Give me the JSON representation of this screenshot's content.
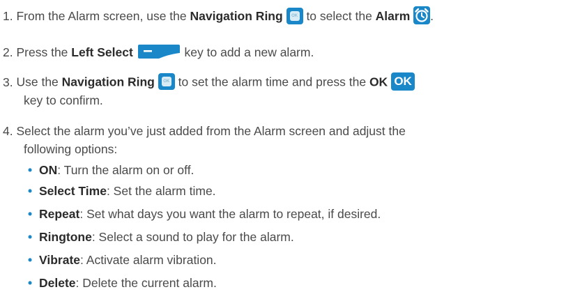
{
  "steps": [
    {
      "num": "1.",
      "t1": "From the Alarm screen, use the ",
      "b1": "Navigation Ring",
      "t2": " to select the ",
      "b2": "Alarm",
      "t3": "."
    },
    {
      "num": "2.",
      "t1": "Press the ",
      "b1": "Left Select",
      "t2": " key to add a new alarm."
    },
    {
      "num": "3.",
      "t1": "Use the ",
      "b1": "Navigation Ring",
      "t2": " to set the alarm time and press the ",
      "b2": "OK",
      "key": "OK",
      "line2": "key to confirm."
    },
    {
      "num": "4.",
      "line1": "Select the alarm you’ve just added from the Alarm screen and adjust the",
      "line2": "following options:"
    }
  ],
  "options": [
    {
      "term": "ON",
      "desc": ": Turn the alarm on or off."
    },
    {
      "term": "Select Time",
      "desc": ": Set the alarm time."
    },
    {
      "term": "Repeat",
      "desc": ": Set what days you want the alarm to repeat, if desired."
    },
    {
      "term": "Ringtone",
      "desc": ": Select a sound to play for the alarm."
    },
    {
      "term": "Vibrate",
      "desc": ": Activate alarm vibration."
    },
    {
      "term": "Delete",
      "desc": ": Delete the current alarm."
    }
  ],
  "colors": {
    "accent": "#1a87c9",
    "text": "#4a4a4a"
  },
  "icons": [
    "navigation-ring-icon",
    "alarm-clock-icon",
    "left-select-key-icon",
    "ok-key-icon"
  ]
}
